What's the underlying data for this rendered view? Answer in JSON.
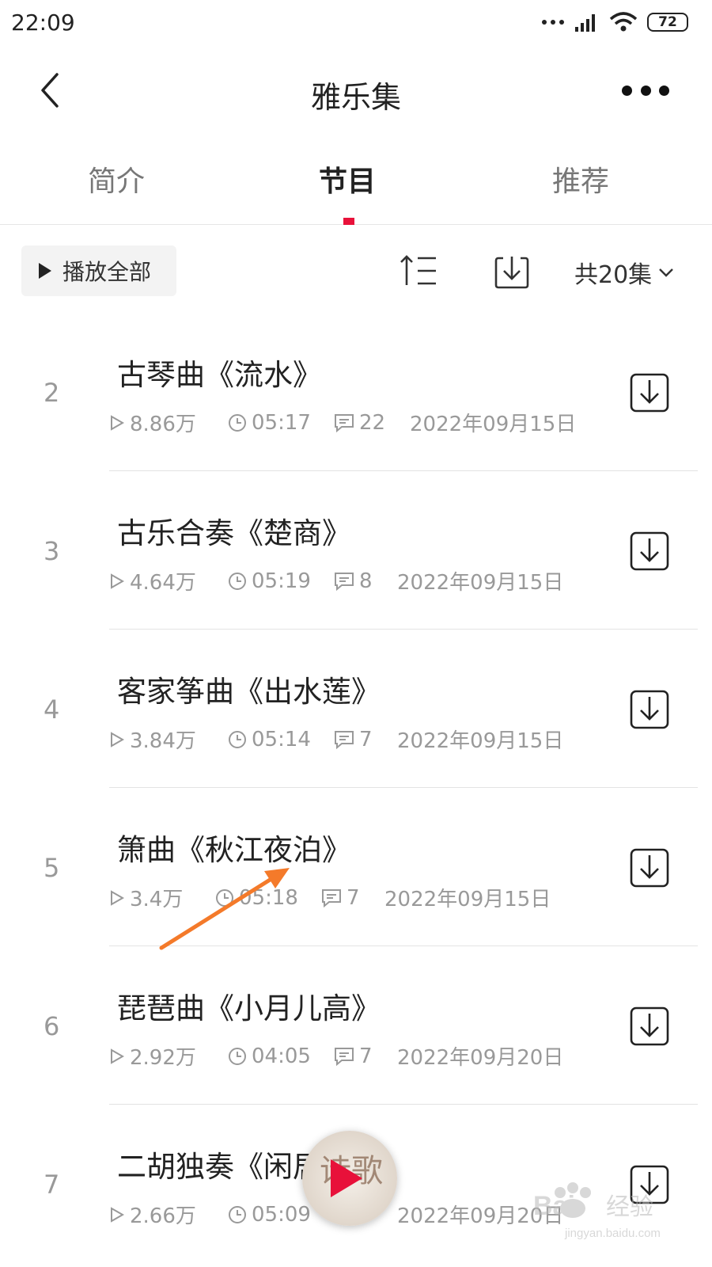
{
  "status_bar": {
    "time": "22:09",
    "battery": "72",
    "icons": [
      "dots-icon",
      "signal-icon",
      "wifi-icon",
      "battery-icon"
    ]
  },
  "nav": {
    "title": "雅乐集",
    "back_icon": "chevron-left-icon",
    "more_icon": "more-dots-icon"
  },
  "tabs": [
    {
      "label": "简介",
      "active": false
    },
    {
      "label": "节目",
      "active": true
    },
    {
      "label": "推荐",
      "active": false
    }
  ],
  "toolbar": {
    "play_all": "播放全部",
    "sort_icon": "sort-icon",
    "download_icon": "download-icon",
    "episode_count": "共20集"
  },
  "episodes": [
    {
      "num": "2",
      "title": "古琴曲《流水》",
      "plays": "8.86万",
      "duration": "05:17",
      "comments": "22",
      "date": "2022年09月15日"
    },
    {
      "num": "3",
      "title": "古乐合奏《楚商》",
      "plays": "4.64万",
      "duration": "05:19",
      "comments": "8",
      "date": "2022年09月15日"
    },
    {
      "num": "4",
      "title": "客家筝曲《出水莲》",
      "plays": "3.84万",
      "duration": "05:14",
      "comments": "7",
      "date": "2022年09月15日"
    },
    {
      "num": "5",
      "title": "箫曲《秋江夜泊》",
      "plays": "3.4万",
      "duration": "05:18",
      "comments": "7",
      "date": "2022年09月15日"
    },
    {
      "num": "6",
      "title": "琵琶曲《小月儿高》",
      "plays": "2.92万",
      "duration": "04:05",
      "comments": "7",
      "date": "2022年09月20日"
    },
    {
      "num": "7",
      "title": "二胡独奏《闲居吟》",
      "plays": "2.66万",
      "duration": "05:09",
      "comments": "",
      "date": "2022年09月20日"
    }
  ],
  "mini_player": {
    "cover_text": "诗歌"
  },
  "watermark": {
    "text": "Baidu经验",
    "sub": "jingyan.baidu.com"
  },
  "colors": {
    "accent": "#e8113a",
    "annotation_arrow": "#f47a2a",
    "muted": "#999999"
  }
}
